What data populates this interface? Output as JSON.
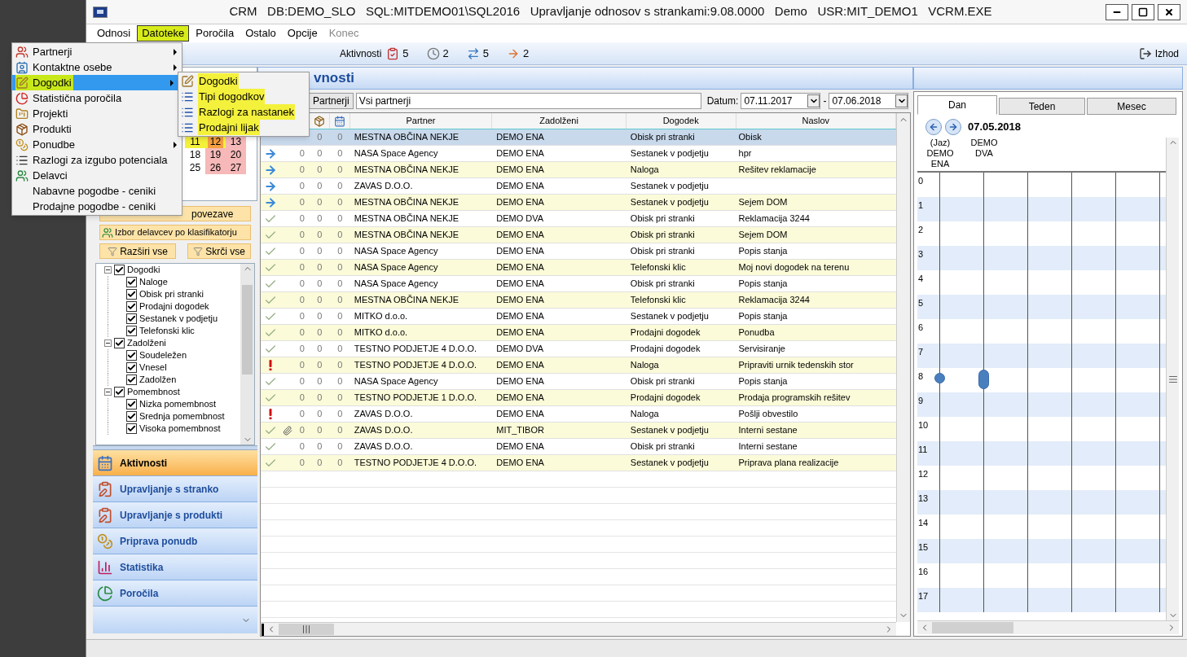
{
  "window": {
    "title": "CRM   DB:DEMO_SLO   SQL:MITDEMO01\\SQL2016   Upravljanje odnosov s strankami:9.08.0000   Demo   USR:MIT_DEMO1   VCRM.EXE"
  },
  "menu_bar": [
    {
      "label": "Odnosi",
      "selected": false,
      "highlighted": false,
      "disabled": false
    },
    {
      "label": "Datoteke",
      "selected": true,
      "highlighted": true,
      "disabled": false
    },
    {
      "label": "Poročila",
      "selected": false,
      "highlighted": false,
      "disabled": false
    },
    {
      "label": "Ostalo",
      "selected": false,
      "highlighted": false,
      "disabled": false
    },
    {
      "label": "Opcije",
      "selected": false,
      "highlighted": false,
      "disabled": false
    },
    {
      "label": "Konec",
      "selected": false,
      "highlighted": false,
      "disabled": true
    }
  ],
  "dropdown": [
    {
      "label": "Partnerji",
      "submenu": true,
      "selected": false,
      "highlighted": false
    },
    {
      "label": "Kontaktne osebe",
      "submenu": true,
      "selected": false,
      "highlighted": false
    },
    {
      "label": "Dogodki",
      "submenu": true,
      "selected": true,
      "highlighted": true
    },
    {
      "label": "Statistična poročila",
      "submenu": false,
      "selected": false,
      "highlighted": false
    },
    {
      "label": "Projekti",
      "submenu": false,
      "selected": false,
      "highlighted": false
    },
    {
      "label": "Produkti",
      "submenu": false,
      "selected": false,
      "highlighted": false
    },
    {
      "label": "Ponudbe",
      "submenu": true,
      "selected": false,
      "highlighted": false
    },
    {
      "label": "Razlogi za izgubo potenciala",
      "submenu": false,
      "selected": false,
      "highlighted": false
    },
    {
      "label": "Delavci",
      "submenu": false,
      "selected": false,
      "highlighted": false
    },
    {
      "label": "Nabavne pogodbe - ceniki",
      "submenu": false,
      "selected": false,
      "highlighted": false
    },
    {
      "label": "Prodajne pogodbe - ceniki",
      "submenu": false,
      "selected": false,
      "highlighted": false
    }
  ],
  "submenu": [
    {
      "label": "Dogodki",
      "highlighted": true
    },
    {
      "label": "Tipi dogodkov",
      "highlighted": true
    },
    {
      "label": "Razlogi za nastanek",
      "highlighted": true
    },
    {
      "label": "Prodajni lijak",
      "highlighted": true
    }
  ],
  "toolbar": {
    "label": "Aktivnosti",
    "counters": [
      "5",
      "2",
      "5",
      "2"
    ],
    "exit": "Izhod"
  },
  "mini_calendar": [
    [
      {
        "day": "11",
        "kind": "weekday",
        "highlighted": true
      },
      {
        "day": "12",
        "kind": "today",
        "highlighted": true
      },
      {
        "day": "13",
        "kind": "weekend",
        "highlighted": false
      }
    ],
    [
      {
        "day": "18",
        "kind": "weekday",
        "highlighted": false
      },
      {
        "day": "19",
        "kind": "weekend",
        "highlighted": false
      },
      {
        "day": "20",
        "kind": "weekend",
        "highlighted": false
      }
    ],
    [
      {
        "day": "25",
        "kind": "weekday",
        "highlighted": false
      },
      {
        "day": "26",
        "kind": "weekend",
        "highlighted": false
      },
      {
        "day": "27",
        "kind": "weekend",
        "highlighted": false
      }
    ]
  ],
  "side_buttons": {
    "links": "povezave",
    "classifier": "Izbor delavcev po klasifikatorju",
    "expand": "Razširi vse",
    "collapse": "Skrči vse"
  },
  "filter_tree": [
    {
      "label": "Dogodki",
      "checked": true,
      "expanded": true,
      "children": [
        {
          "label": "Naloge",
          "checked": true
        },
        {
          "label": "Obisk pri stranki",
          "checked": true
        },
        {
          "label": "Prodajni dogodek",
          "checked": true
        },
        {
          "label": "Sestanek v podjetju",
          "checked": true
        },
        {
          "label": "Telefonski klic",
          "checked": true
        }
      ]
    },
    {
      "label": "Zadolženi",
      "checked": true,
      "expanded": true,
      "children": [
        {
          "label": "Soudeležen",
          "checked": true
        },
        {
          "label": "Vnesel",
          "checked": true
        },
        {
          "label": "Zadolžen",
          "checked": true
        }
      ]
    },
    {
      "label": "Pomembnost",
      "checked": true,
      "expanded": true,
      "children": [
        {
          "label": "Nizka pomembnost",
          "checked": true
        },
        {
          "label": "Srednja pomembnost",
          "checked": true
        },
        {
          "label": "Visoka pomembnost",
          "checked": true
        }
      ]
    }
  ],
  "nav": [
    {
      "label": "Aktivnosti",
      "selected": true
    },
    {
      "label": "Upravljanje s stranko",
      "selected": false
    },
    {
      "label": "Upravljanje s produkti",
      "selected": false
    },
    {
      "label": "Priprava ponudb",
      "selected": false
    },
    {
      "label": "Statistika",
      "selected": false
    },
    {
      "label": "Poročila",
      "selected": false
    }
  ],
  "panel_title": "vnosti",
  "filter": {
    "button": "Partnerji",
    "value": "Vsi partnerji",
    "date_label": "Datum:",
    "from": "07.11.2017",
    "separator": "-",
    "to": "07.06.2018"
  },
  "table": {
    "columns": [
      "Partner",
      "Zadolženi",
      "Dogodek",
      "Naslov"
    ],
    "rows": [
      {
        "selected": true,
        "counts": [
          "0",
          "0"
        ],
        "partner": "MESTNA OBČINA NEKJE",
        "assigned": "DEMO ENA",
        "event": "Obisk pri stranki",
        "title": "Obisk"
      },
      {
        "selected": false,
        "kind": "forward",
        "counts": [
          "0",
          "0",
          "0"
        ],
        "partner": "NASA Space Agency",
        "assigned": "DEMO ENA",
        "event": "Sestanek v podjetju",
        "title": "hpr"
      },
      {
        "selected": false,
        "kind": "forward",
        "counts": [
          "0",
          "0",
          "0"
        ],
        "partner": "MESTNA OBČINA NEKJE",
        "assigned": "DEMO ENA",
        "event": "Naloga",
        "title": "Rešitev reklamacije"
      },
      {
        "selected": false,
        "kind": "forward",
        "counts": [
          "0",
          "0",
          "0"
        ],
        "partner": "ZAVAS D.O.O.",
        "assigned": "DEMO ENA",
        "event": "Sestanek v podjetju"
      },
      {
        "selected": false,
        "kind": "forward",
        "counts": [
          "0",
          "0",
          "0"
        ],
        "partner": "MESTNA OBČINA NEKJE",
        "assigned": "DEMO ENA",
        "event": "Sestanek v podjetju",
        "title": "Sejem DOM"
      },
      {
        "selected": false,
        "kind": "done",
        "counts": [
          "0",
          "0",
          "0"
        ],
        "partner": "MESTNA OBČINA NEKJE",
        "assigned": "DEMO DVA",
        "event": "Obisk pri stranki",
        "title": "Reklamacija 3244"
      },
      {
        "selected": false,
        "kind": "done",
        "counts": [
          "0",
          "0",
          "0"
        ],
        "partner": "MESTNA OBČINA NEKJE",
        "assigned": "DEMO ENA",
        "event": "Obisk pri stranki",
        "title": "Sejem DOM"
      },
      {
        "selected": false,
        "kind": "done",
        "counts": [
          "0",
          "0",
          "0"
        ],
        "partner": "NASA Space Agency",
        "assigned": "DEMO ENA",
        "event": "Obisk pri stranki",
        "title": "Popis stanja"
      },
      {
        "selected": false,
        "kind": "done",
        "counts": [
          "0",
          "0",
          "0"
        ],
        "partner": "NASA Space Agency",
        "assigned": "DEMO ENA",
        "event": "Telefonski klic",
        "title": "Moj novi dogodek na terenu"
      },
      {
        "selected": false,
        "kind": "done",
        "counts": [
          "0",
          "0",
          "0"
        ],
        "partner": "NASA Space Agency",
        "assigned": "DEMO ENA",
        "event": "Obisk pri stranki",
        "title": "Popis stanja"
      },
      {
        "selected": false,
        "kind": "done",
        "counts": [
          "0",
          "0",
          "0"
        ],
        "partner": "MESTNA OBČINA NEKJE",
        "assigned": "DEMO ENA",
        "event": "Telefonski klic",
        "title": "Reklamacija 3244"
      },
      {
        "selected": false,
        "kind": "done",
        "counts": [
          "0",
          "0",
          "0"
        ],
        "partner": "MITKO d.o.o.",
        "assigned": "DEMO ENA",
        "event": "Sestanek v podjetju",
        "title": "Popis stanja"
      },
      {
        "selected": false,
        "kind": "done",
        "counts": [
          "0",
          "0",
          "0"
        ],
        "partner": "MITKO d.o.o.",
        "assigned": "DEMO ENA",
        "event": "Prodajni dogodek",
        "title": "Ponudba"
      },
      {
        "selected": false,
        "kind": "done",
        "counts": [
          "0",
          "0",
          "0"
        ],
        "partner": "TESTNO PODJETJE 4 D.O.O.",
        "assigned": "DEMO DVA",
        "event": "Prodajni dogodek",
        "title": "Servisiranje"
      },
      {
        "selected": false,
        "kind": "urgent",
        "counts": [
          "0",
          "0",
          "0"
        ],
        "partner": "TESTNO PODJETJE 4 D.O.O.",
        "assigned": "DEMO ENA",
        "event": "Naloga",
        "title": "Pripraviti urnik tedenskih stor"
      },
      {
        "selected": false,
        "kind": "done",
        "counts": [
          "0",
          "0",
          "0"
        ],
        "partner": "NASA Space Agency",
        "assigned": "DEMO ENA",
        "event": "Obisk pri stranki",
        "title": "Popis stanja"
      },
      {
        "selected": false,
        "kind": "done",
        "counts": [
          "0",
          "0",
          "0"
        ],
        "partner": "TESTNO PODJETJE 1 D.O.O.",
        "assigned": "DEMO ENA",
        "event": "Prodajni dogodek",
        "title": "Prodaja programskih rešitev"
      },
      {
        "selected": false,
        "kind": "urgent",
        "counts": [
          "0",
          "0",
          "0"
        ],
        "partner": "ZAVAS D.O.O.",
        "assigned": "DEMO ENA",
        "event": "Naloga",
        "title": "Pošlji obvestilo"
      },
      {
        "selected": false,
        "kind": "done",
        "attachment": true,
        "counts": [
          "0",
          "0",
          "0"
        ],
        "partner": "ZAVAS D.O.O.",
        "assigned": "MIT_TIBOR",
        "event": "Sestanek v podjetju",
        "title": "Interni sestane"
      },
      {
        "selected": false,
        "kind": "done",
        "counts": [
          "0",
          "0",
          "0"
        ],
        "partner": "ZAVAS D.O.O.",
        "assigned": "DEMO ENA",
        "event": "Obisk pri stranki",
        "title": "Interni sestane"
      },
      {
        "selected": false,
        "kind": "done",
        "counts": [
          "0",
          "0",
          "0"
        ],
        "partner": "TESTNO PODJETJE 4 D.O.O.",
        "assigned": "DEMO ENA",
        "event": "Sestanek v podjetju",
        "title": "Priprava plana realizacije"
      }
    ]
  },
  "calendar": {
    "tabs": [
      {
        "label": "Dan",
        "selected": true
      },
      {
        "label": "Teden",
        "selected": false
      },
      {
        "label": "Mesec",
        "selected": false
      }
    ],
    "date": "07.05.2018",
    "resources": [
      "(Jaz) DEMO ENA",
      "DEMO DVA"
    ],
    "hours": [
      {
        "label": "0"
      },
      {
        "label": "1"
      },
      {
        "label": "2"
      },
      {
        "label": "3"
      },
      {
        "label": "4"
      },
      {
        "label": "5"
      },
      {
        "label": "6"
      },
      {
        "label": "7"
      },
      {
        "label": "8",
        "events": [
          {
            "kind": "dot"
          },
          {
            "kind": "bar"
          }
        ]
      },
      {
        "label": "9"
      },
      {
        "label": "10"
      },
      {
        "label": "11"
      },
      {
        "label": "12"
      },
      {
        "label": "13"
      },
      {
        "label": "14"
      },
      {
        "label": "15"
      },
      {
        "label": "16"
      },
      {
        "label": "17"
      }
    ]
  }
}
